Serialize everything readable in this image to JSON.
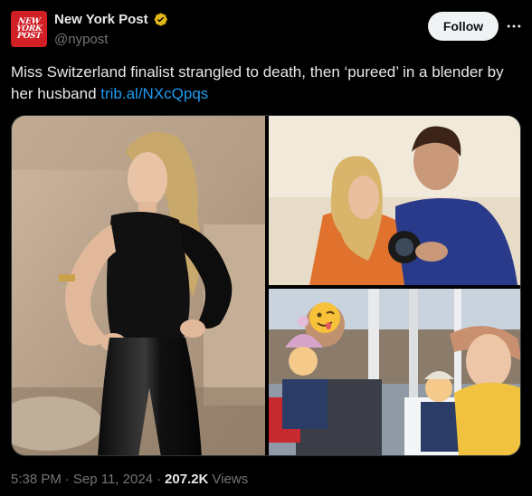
{
  "account": {
    "display_name": "New York Post",
    "handle": "@nypost",
    "verified": true,
    "verified_badge_color": "#e2b719",
    "avatar_logo_lines": [
      "NEW",
      "YORK",
      "POST"
    ],
    "avatar_color": "#d11f26"
  },
  "actions": {
    "follow_label": "Follow",
    "more_icon": "more-horizontal-icon"
  },
  "tweet": {
    "text": "Miss Switzerland finalist strangled to death, then ‘pureed’ in a blender by her husband ",
    "link_text": "trib.al/NXcQpqs",
    "link_color": "#1d9bf0"
  },
  "media": {
    "photo_count": 3
  },
  "meta": {
    "time": "5:38 PM",
    "separator": "·",
    "date": "Sep 11, 2024",
    "views_count": "207.2K",
    "views_label": "Views"
  }
}
